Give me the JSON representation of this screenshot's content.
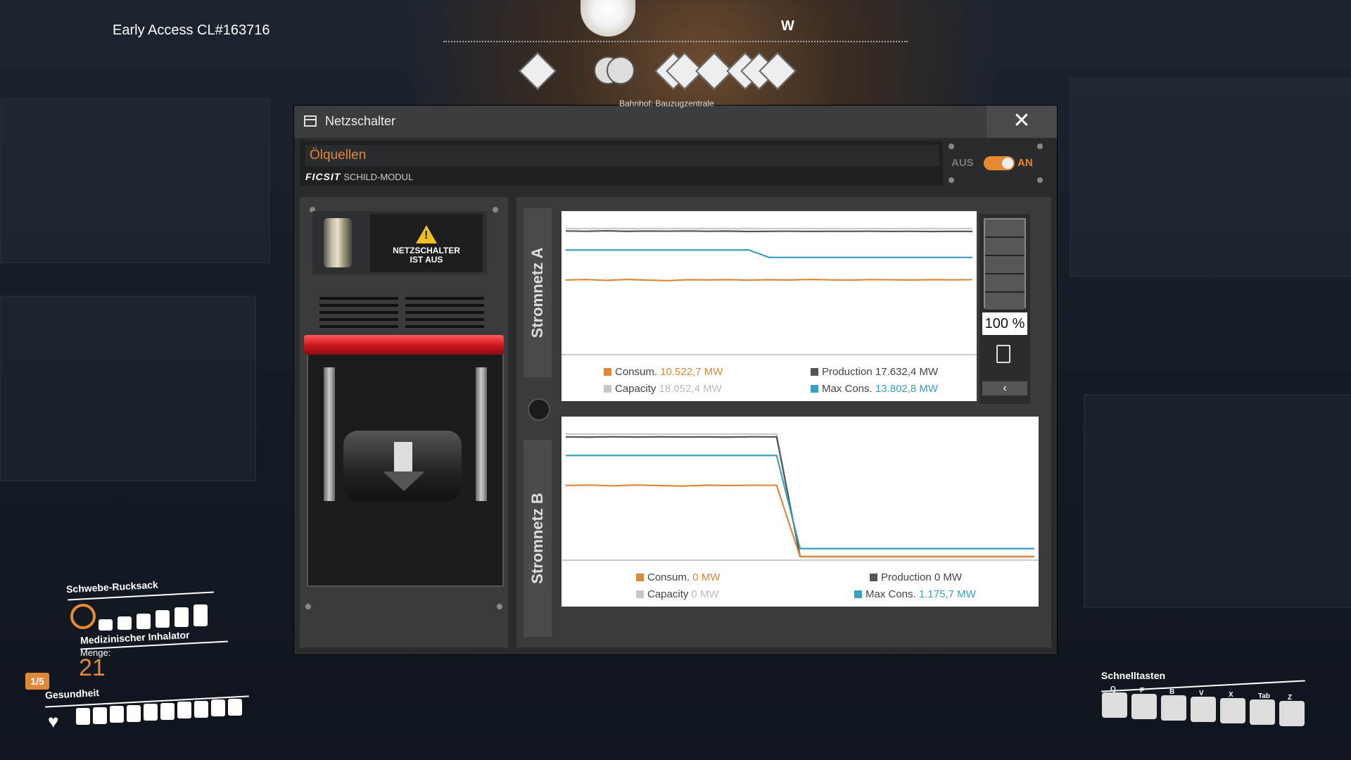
{
  "hud": {
    "build_label": "Early Access CL#163716",
    "compass_heading": "W",
    "station_label": "Bahnhof: Bauzugzentrale"
  },
  "window": {
    "title": "Netzschalter",
    "close_glyph": "✕",
    "name_value": "Ölquellen",
    "brand": "FICSIT",
    "module_label": "SCHILD-MODUL",
    "toggle_off_label": "AUS",
    "toggle_on_label": "AN",
    "toggle_state": "on"
  },
  "switch_panel": {
    "warning_line1": "NETZSCHALTER",
    "warning_line2": "IST AUS"
  },
  "circuit_a": {
    "label": "Stromnetz A",
    "legend": {
      "consum_label": "Consum.",
      "consum_value": "10.522,7 MW",
      "production_label": "Production",
      "production_value": "17.632,4 MW",
      "capacity_label": "Capacity",
      "capacity_value": "18.052,4 MW",
      "maxcons_label": "Max Cons.",
      "maxcons_value": "13.802,8 MW"
    }
  },
  "circuit_b": {
    "label": "Stromnetz B",
    "legend": {
      "consum_label": "Consum.",
      "consum_value": "0 MW",
      "production_label": "Production",
      "production_value": "0 MW",
      "capacity_label": "Capacity",
      "capacity_value": "0 MW",
      "maxcons_label": "Max Cons.",
      "maxcons_value": "1.175,7 MW"
    }
  },
  "battery": {
    "percent_label": "100 %",
    "collapse_glyph": "‹",
    "charge_fraction": 1.0
  },
  "chart_data": [
    {
      "type": "line",
      "title": "Stromnetz A",
      "x": [
        0,
        1,
        2,
        3,
        4,
        5,
        6,
        7,
        8,
        9,
        10,
        11,
        12,
        13,
        14,
        15,
        16,
        17,
        18,
        19,
        20
      ],
      "series": [
        {
          "name": "Capacity",
          "color": "#c8c8c8",
          "values": [
            18052,
            18052,
            18052,
            18052,
            18052,
            18052,
            18052,
            18052,
            18052,
            18052,
            18052,
            18052,
            18052,
            18052,
            18052,
            18052,
            18052,
            18052,
            18052,
            18052,
            18052
          ]
        },
        {
          "name": "Production",
          "color": "#555555",
          "values": [
            17700,
            17650,
            17720,
            17640,
            17690,
            17660,
            17700,
            17650,
            17680,
            17620,
            17640,
            17660,
            17630,
            17650,
            17640,
            17660,
            17630,
            17650,
            17620,
            17640,
            17632
          ]
        },
        {
          "name": "Max Cons.",
          "color": "#3aa0c0",
          "values": [
            14900,
            14900,
            14900,
            14900,
            14900,
            14900,
            14900,
            14900,
            14900,
            14900,
            13803,
            13803,
            13803,
            13803,
            13803,
            13803,
            13803,
            13803,
            13803,
            13803,
            13803
          ]
        },
        {
          "name": "Consum.",
          "color": "#e0883a",
          "values": [
            10480,
            10550,
            10420,
            10560,
            10470,
            10380,
            10520,
            10490,
            10530,
            10460,
            10520,
            10480,
            10560,
            10500,
            10470,
            10540,
            10510,
            10480,
            10530,
            10500,
            10523
          ]
        }
      ],
      "ylim": [
        0,
        20000
      ],
      "grid": false
    },
    {
      "type": "line",
      "title": "Stromnetz B",
      "x": [
        0,
        1,
        2,
        3,
        4,
        5,
        6,
        7,
        8,
        9,
        10,
        11,
        12,
        13,
        14,
        15,
        16,
        17,
        18,
        19,
        20
      ],
      "series": [
        {
          "name": "Capacity",
          "color": "#c8c8c8",
          "values": [
            18052,
            18052,
            18052,
            18052,
            18052,
            18052,
            18052,
            18052,
            18052,
            18052,
            0,
            0,
            0,
            0,
            0,
            0,
            0,
            0,
            0,
            0,
            0
          ]
        },
        {
          "name": "Production",
          "color": "#555555",
          "values": [
            17632,
            17600,
            17650,
            17610,
            17640,
            17620,
            17630,
            17600,
            17650,
            17630,
            0,
            0,
            0,
            0,
            0,
            0,
            0,
            0,
            0,
            0,
            0
          ]
        },
        {
          "name": "Max Cons.",
          "color": "#3aa0c0",
          "values": [
            14900,
            14900,
            14900,
            14900,
            14900,
            14900,
            14900,
            14900,
            14900,
            14900,
            1176,
            1176,
            1176,
            1176,
            1176,
            1176,
            1176,
            1176,
            1176,
            1176,
            1176
          ]
        },
        {
          "name": "Consum.",
          "color": "#e0883a",
          "values": [
            10480,
            10540,
            10420,
            10550,
            10470,
            10390,
            10520,
            10480,
            10510,
            10500,
            0,
            0,
            0,
            0,
            0,
            0,
            0,
            0,
            0,
            0,
            0
          ]
        }
      ],
      "ylim": [
        0,
        20000
      ],
      "grid": false
    }
  ],
  "hud_bottom": {
    "jetpack_label": "Schwebe-Rucksack",
    "inhaler_label": "Medizinischer Inhalator",
    "menge_label": "Menge:",
    "menge_value": "21",
    "inhaler_fraction": "1/5",
    "health_label": "Gesundheit",
    "quickslots_title": "Schnelltasten",
    "quickslot_keys": [
      "Q",
      "F",
      "B",
      "V",
      "X",
      "Tab",
      "Z"
    ],
    "jetpack_fuel_fraction": 1.0,
    "health_fraction": 1.0
  }
}
